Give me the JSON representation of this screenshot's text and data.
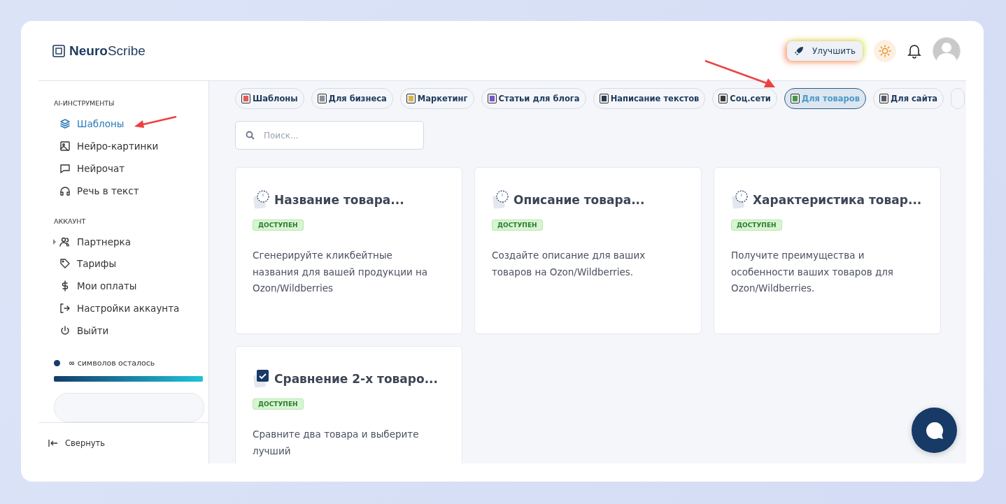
{
  "logo": {
    "bold": "Neuro",
    "light": "Scribe"
  },
  "header": {
    "upgrade_button": "Улучшить"
  },
  "sidebar": {
    "sections": [
      {
        "title": "AI-ИНСТРУМЕНТЫ",
        "items": [
          {
            "label": "Шаблоны",
            "selected": true
          },
          {
            "label": "Нейро-картинки",
            "selected": false
          },
          {
            "label": "Нейрочат",
            "selected": false
          },
          {
            "label": "Речь в текст",
            "selected": false
          }
        ]
      },
      {
        "title": "АККАУНТ",
        "items": [
          {
            "label": "Партнерка",
            "selected": false,
            "expanded": false
          },
          {
            "label": "Тарифы",
            "selected": false
          },
          {
            "label": "Мои оплаты",
            "selected": false
          },
          {
            "label": "Настройки аккаунта",
            "selected": false
          },
          {
            "label": "Выйти",
            "selected": false
          }
        ]
      }
    ],
    "symbols": {
      "count": "∞",
      "label": "символов осталось",
      "level": 1
    },
    "collapse": "Свернуть"
  },
  "categories": [
    {
      "label": "Шаблоны",
      "selected": false
    },
    {
      "label": "Для бизнеса",
      "selected": false
    },
    {
      "label": "Маркетинг",
      "selected": false
    },
    {
      "label": "Статьи для блога",
      "selected": false
    },
    {
      "label": "Написание текстов",
      "selected": false
    },
    {
      "label": "Соц.сети",
      "selected": false
    },
    {
      "label": "Для товаров",
      "selected": true
    },
    {
      "label": "Для сайта",
      "selected": false
    }
  ],
  "search": {
    "placeholder": "Поиск..."
  },
  "cards": [
    {
      "title": "Название товара...",
      "kind": "clock",
      "badge": "ДОСТУПЕН",
      "description": "Сгенерируйте кликбейтные названия для вашей продукции на Ozon/Wildberries"
    },
    {
      "title": "Описание товара...",
      "kind": "clock",
      "badge": "ДОСТУПЕН",
      "description": "Создайте описание для ваших товаров на Ozon/Wildberries."
    },
    {
      "title": "Характеристика товар...",
      "kind": "clock",
      "badge": "ДОСТУПЕН",
      "description": "Получите преимущества и особенности ваших товаров для Ozon/Wildberries."
    },
    {
      "title": "Сравнение 2-х товаро...",
      "kind": "check",
      "badge": "ДОСТУПЕН",
      "description": "Сравните два товара и выберите лучший"
    }
  ]
}
